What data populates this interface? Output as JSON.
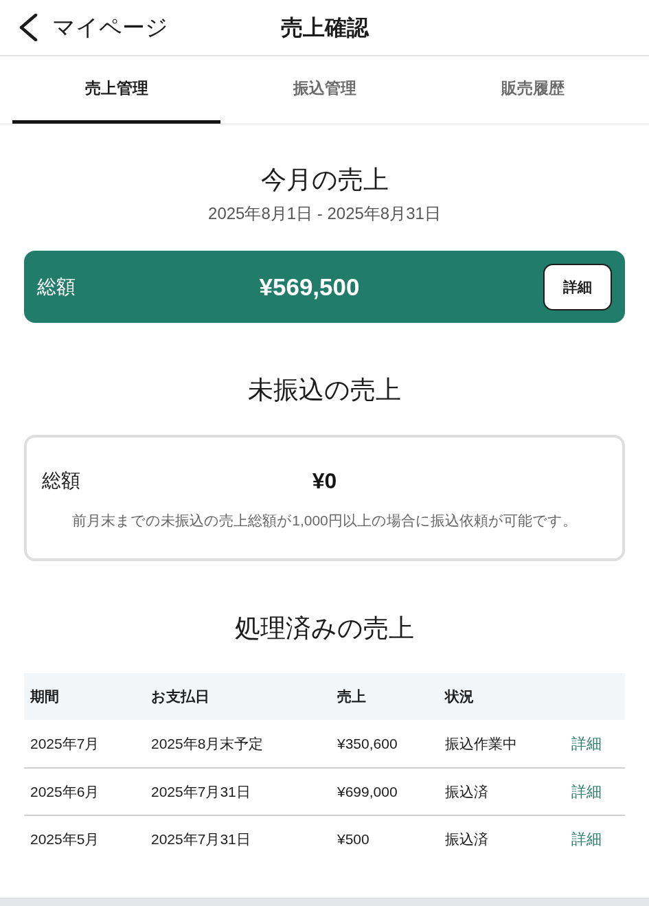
{
  "header": {
    "back_label": "マイページ",
    "title": "売上確認"
  },
  "tabs": [
    {
      "label": "売上管理",
      "selected": true
    },
    {
      "label": "振込管理",
      "selected": false
    },
    {
      "label": "販売履歴",
      "selected": false
    }
  ],
  "this_month": {
    "heading": "今月の売上",
    "period": "2025年8月1日 - 2025年8月31日",
    "total_label": "総額",
    "total": "¥569,500",
    "detail_button": "詳細"
  },
  "unpaid": {
    "heading": "未振込の売上",
    "total_label": "総額",
    "total": "¥0",
    "note": "前月末までの未振込の売上総額が1,000円以上の場合に振込依頼が可能です。"
  },
  "processed": {
    "heading": "処理済みの売上",
    "table": {
      "columns": [
        "期間",
        "お支払日",
        "売上",
        "状況"
      ],
      "rows": [
        {
          "period": "2025年7月",
          "payment_date": "2025年8月末予定",
          "sales": "¥350,600",
          "status": "振込作業中",
          "action": "詳細"
        },
        {
          "period": "2025年6月",
          "payment_date": "2025年7月31日",
          "sales": "¥699,000",
          "status": "振込済",
          "action": "詳細"
        },
        {
          "period": "2025年5月",
          "payment_date": "2025年7月31日",
          "sales": "¥500",
          "status": "振込済",
          "action": "詳細"
        }
      ]
    }
  }
}
